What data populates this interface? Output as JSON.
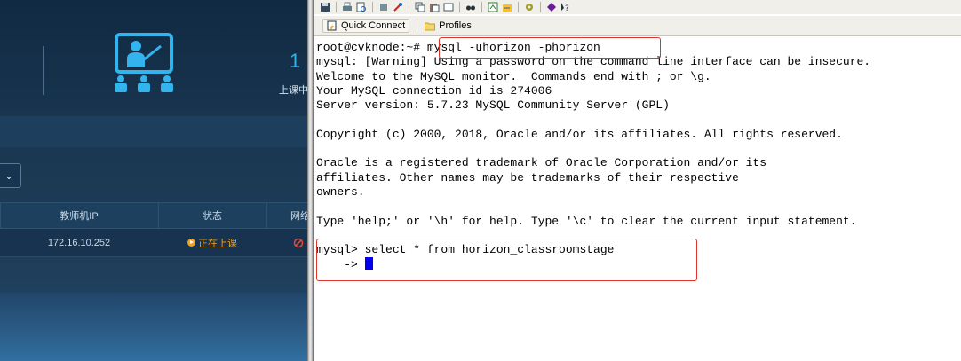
{
  "dashboard": {
    "stat": {
      "value": "1",
      "label": "上课中"
    },
    "dropdown_glyph": "⌄",
    "table": {
      "headers": [
        "教师机IP",
        "状态",
        "网络"
      ],
      "rows": [
        {
          "ip": "172.16.10.252",
          "status": "正在上课"
        }
      ]
    },
    "colors": {
      "accent": "#34b4ec",
      "status": "#f2a11d"
    }
  },
  "terminal_app": {
    "quick_connect_label": "Quick Connect",
    "profiles_label": "Profiles",
    "lines": [
      "root@cvknode:~# mysql -uhorizon -phorizon",
      "mysql: [Warning] Using a password on the command line interface can be insecure.",
      "Welcome to the MySQL monitor.  Commands end with ; or \\g.",
      "Your MySQL connection id is 274006",
      "Server version: 5.7.23 MySQL Community Server (GPL)",
      "",
      "Copyright (c) 2000, 2018, Oracle and/or its affiliates. All rights reserved.",
      "",
      "Oracle is a registered trademark of Oracle Corporation and/or its",
      "affiliates. Other names may be trademarks of their respective",
      "owners.",
      "",
      "Type 'help;' or '\\h' for help. Type '\\c' to clear the current input statement.",
      "",
      "mysql> select * from horizon_classroomstage"
    ],
    "continuation_prompt": "    -> ",
    "highlight_color": "#d9372d"
  }
}
